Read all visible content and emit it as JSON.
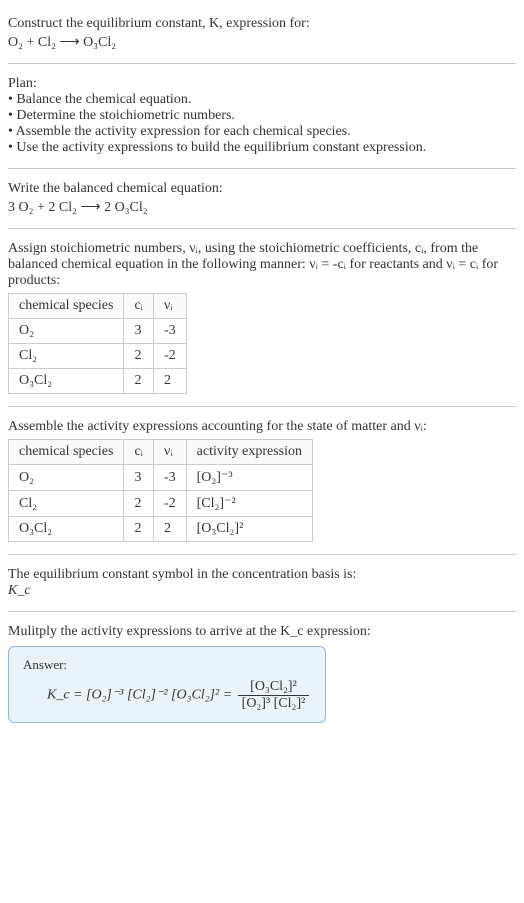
{
  "intro": {
    "line1": "Construct the equilibrium constant, K, expression for:",
    "reaction_unbalanced": "O₂ + Cl₂ ⟶ O₃Cl₂"
  },
  "plan": {
    "heading": "Plan:",
    "b1": "• Balance the chemical equation.",
    "b2": "• Determine the stoichiometric numbers.",
    "b3": "• Assemble the activity expression for each chemical species.",
    "b4": "• Use the activity expressions to build the equilibrium constant expression."
  },
  "balanced": {
    "heading": "Write the balanced chemical equation:",
    "reaction": "3 O₂ + 2 Cl₂ ⟶ 2 O₃Cl₂"
  },
  "stoich": {
    "text_a": "Assign stoichiometric numbers, νᵢ, using the stoichiometric coefficients, cᵢ, from the balanced chemical equation in the following manner: νᵢ = -cᵢ for reactants and νᵢ = cᵢ for products:",
    "headers": {
      "species": "chemical species",
      "c": "cᵢ",
      "v": "νᵢ"
    },
    "rows": [
      {
        "species": "O₂",
        "c": "3",
        "v": "-3"
      },
      {
        "species": "Cl₂",
        "c": "2",
        "v": "-2"
      },
      {
        "species": "O₃Cl₂",
        "c": "2",
        "v": "2"
      }
    ]
  },
  "activity": {
    "heading": "Assemble the activity expressions accounting for the state of matter and νᵢ:",
    "headers": {
      "species": "chemical species",
      "c": "cᵢ",
      "v": "νᵢ",
      "expr": "activity expression"
    },
    "rows": [
      {
        "species": "O₂",
        "c": "3",
        "v": "-3",
        "expr": "[O₂]⁻³"
      },
      {
        "species": "Cl₂",
        "c": "2",
        "v": "-2",
        "expr": "[Cl₂]⁻²"
      },
      {
        "species": "O₃Cl₂",
        "c": "2",
        "v": "2",
        "expr": "[O₃Cl₂]²"
      }
    ]
  },
  "symbol": {
    "line": "The equilibrium constant symbol in the concentration basis is:",
    "k": "K_c"
  },
  "multiply": {
    "line": "Mulitply the activity expressions to arrive at the K_c expression:"
  },
  "answer": {
    "label": "Answer:",
    "lhs": "K_c = [O₂]⁻³ [Cl₂]⁻² [O₃Cl₂]² =",
    "num": "[O₃Cl₂]²",
    "den": "[O₂]³ [Cl₂]²"
  },
  "chart_data": {
    "type": "table",
    "tables": [
      {
        "title": "Stoichiometric numbers",
        "columns": [
          "chemical species",
          "c_i",
          "ν_i"
        ],
        "rows": [
          [
            "O2",
            3,
            -3
          ],
          [
            "Cl2",
            2,
            -2
          ],
          [
            "O3Cl2",
            2,
            2
          ]
        ]
      },
      {
        "title": "Activity expressions",
        "columns": [
          "chemical species",
          "c_i",
          "ν_i",
          "activity expression"
        ],
        "rows": [
          [
            "O2",
            3,
            -3,
            "[O2]^-3"
          ],
          [
            "Cl2",
            2,
            -2,
            "[Cl2]^-2"
          ],
          [
            "O3Cl2",
            2,
            2,
            "[O3Cl2]^2"
          ]
        ]
      }
    ]
  }
}
